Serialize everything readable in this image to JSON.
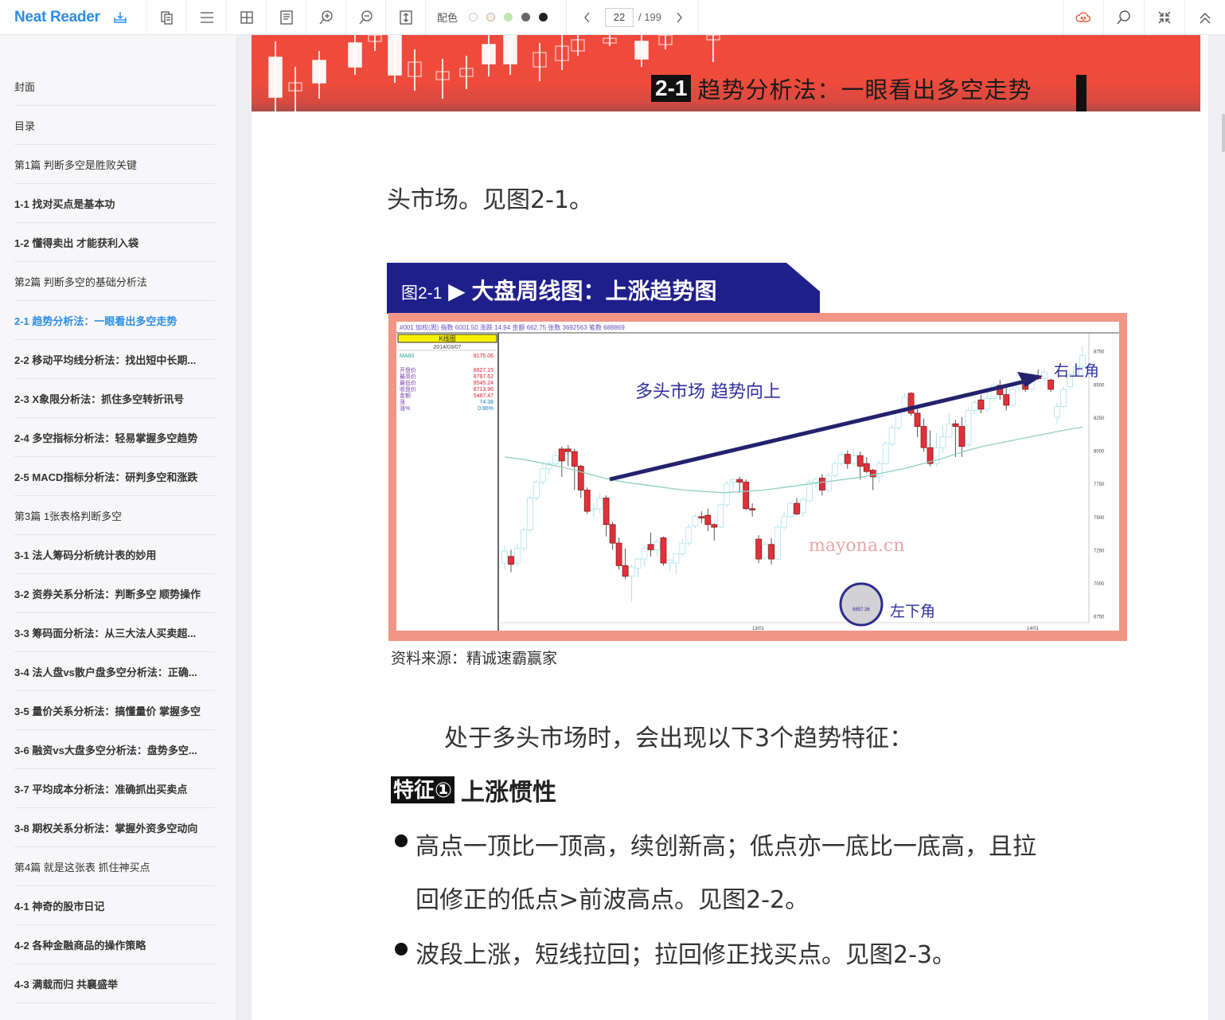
{
  "app": {
    "name": "Neat Reader",
    "icons": [
      "download-icon"
    ]
  },
  "toolbar": {
    "buttons": [
      {
        "name": "dual-page-button",
        "icon": "copy-pages-icon"
      },
      {
        "name": "toc-button",
        "icon": "menu-icon"
      },
      {
        "name": "grid-view-button",
        "icon": "grid-icon"
      },
      {
        "name": "notes-button",
        "icon": "document-icon"
      },
      {
        "name": "zoom-in-button",
        "icon": "zoom-in-icon"
      },
      {
        "name": "zoom-out-button",
        "icon": "zoom-out-icon"
      },
      {
        "name": "fit-height-button",
        "icon": "fit-height-icon"
      }
    ],
    "color_label": "配色",
    "swatches": [
      "#ffffff",
      "#f4eee3",
      "#bfe6b3",
      "#666666",
      "#222222"
    ],
    "page_current": "22",
    "page_total": "/ 199",
    "right_buttons": [
      {
        "name": "cloud-sync-button",
        "icon": "cloud-icon",
        "color": "#e8583d"
      },
      {
        "name": "search-button",
        "icon": "search-icon"
      },
      {
        "name": "fullscreen-button",
        "icon": "collapse-icon"
      },
      {
        "name": "collapse-toolbar-button",
        "icon": "chevron-double-up-icon"
      }
    ]
  },
  "sidebar": {
    "active_index": 6,
    "items": [
      {
        "label": "封面",
        "type": "part"
      },
      {
        "label": "目录",
        "type": "part"
      },
      {
        "label": "第1篇 判断多空是胜败关键",
        "type": "part"
      },
      {
        "label": "1-1 找对买点是基本功",
        "type": "chapter"
      },
      {
        "label": "1-2 懂得卖出 才能获利入袋",
        "type": "chapter"
      },
      {
        "label": "第2篇 判断多空的基础分析法",
        "type": "part"
      },
      {
        "label": "2-1 趋势分析法：一眼看出多空走势",
        "type": "chapter"
      },
      {
        "label": "2-2 移动平均线分析法：找出短中长期...",
        "type": "chapter"
      },
      {
        "label": "2-3 X象限分析法：抓住多空转折讯号",
        "type": "chapter"
      },
      {
        "label": "2-4 多空指标分析法：轻易掌握多空趋势",
        "type": "chapter"
      },
      {
        "label": "2-5 MACD指标分析法：研判多空和涨跌",
        "type": "chapter"
      },
      {
        "label": "第3篇 1张表格判断多空",
        "type": "part"
      },
      {
        "label": "3-1 法人筹码分析统计表的妙用",
        "type": "chapter"
      },
      {
        "label": "3-2 资券关系分析法：判断多空 顺势操作",
        "type": "chapter"
      },
      {
        "label": "3-3 筹码面分析法：从三大法人买卖超...",
        "type": "chapter"
      },
      {
        "label": "3-4 法人盘vs散户盘多空分析法：正确...",
        "type": "chapter"
      },
      {
        "label": "3-5 量价关系分析法：搞懂量价 掌握多空",
        "type": "chapter"
      },
      {
        "label": "3-6 融资vs大盘多空分析法：盘势多空...",
        "type": "chapter"
      },
      {
        "label": "3-7 平均成本分析法：准确抓出买卖点",
        "type": "chapter"
      },
      {
        "label": "3-8 期权关系分析法：掌握外资多空动向",
        "type": "chapter"
      },
      {
        "label": "第4篇 就是这张表 抓住神买点",
        "type": "part"
      },
      {
        "label": "4-1 神奇的股市日记",
        "type": "chapter"
      },
      {
        "label": "4-2 各种金融商品的操作策略",
        "type": "chapter"
      },
      {
        "label": "4-3 满载而归 共襄盛举",
        "type": "chapter"
      }
    ]
  },
  "page": {
    "banner_num": "2-1",
    "banner_title": "趋势分析法：一眼看出多空走势",
    "para1": "头市场。见图2-1。",
    "figure_no": "图2-1",
    "figure_arrow": "▶",
    "figure_title": "大盘周线图：上涨趋势图",
    "source": "资料来源：精诚速霸赢家",
    "para2": "处于多头市场时，会出现以下3个趋势特征：",
    "feature_tag": "特征①",
    "feature_title": "上涨惯性",
    "bullet1_line1": "高点一顶比一顶高，续创新高；低点亦一底比一底高，且拉",
    "bullet1_line2": "回修正的低点>前波高点。见图2-2。",
    "bullet2": "波段上涨，短线拉回；拉回修正找买点。见图2-3。"
  },
  "chart_data": {
    "type": "candlestick",
    "title": "大盘周线图：上涨趋势图",
    "header_line": [
      "#001 加权(周)",
      "指数",
      "6001.50",
      "涨跌",
      "14.94",
      "金额",
      "662.75",
      "张数",
      "3692563",
      "笔数",
      "688869"
    ],
    "info_panel": {
      "title": "K线图",
      "date": "2014/03/07",
      "ma_label": "MA60",
      "ma_value": "8175.06",
      "rows": [
        {
          "label": "开盘价",
          "value": "8627.15"
        },
        {
          "label": "最高价",
          "value": "8787.62"
        },
        {
          "label": "最低价",
          "value": "8545.24"
        },
        {
          "label": "收盘价",
          "value": "8713.96"
        },
        {
          "label": "金额",
          "value": "5487.47"
        },
        {
          "label": "涨",
          "value": "74.38"
        },
        {
          "label": "涨%",
          "value": "0.86%"
        }
      ]
    },
    "yticks": [
      6750,
      7000,
      7250,
      7500,
      7750,
      8000,
      8250,
      8500,
      8750
    ],
    "ylim": [
      6700,
      8850
    ],
    "xticks": [
      "13/01",
      "14/01"
    ],
    "annotations": {
      "trend_label": "多头市场 趋势向上",
      "top_right_label": "右上角",
      "bottom_left_label": "左下角",
      "high_value": "8787.62",
      "low_value": "6857.36"
    },
    "watermark": "mayona.cn",
    "candles": [
      [
        7150,
        7240,
        7100,
        7280
      ],
      [
        7200,
        7140,
        7080,
        7250
      ],
      [
        7150,
        7260,
        7120,
        7300
      ],
      [
        7260,
        7400,
        7240,
        7420
      ],
      [
        7400,
        7640,
        7380,
        7660
      ],
      [
        7640,
        7760,
        7620,
        7780
      ],
      [
        7760,
        7860,
        7740,
        7900
      ],
      [
        7860,
        7900,
        7820,
        7920
      ],
      [
        7900,
        7960,
        7880,
        7990
      ],
      [
        8010,
        7920,
        7800,
        8030
      ],
      [
        8010,
        7990,
        7880,
        8040
      ],
      [
        7990,
        7880,
        7700,
        8010
      ],
      [
        7880,
        7700,
        7640,
        7890
      ],
      [
        7700,
        7540,
        7520,
        7720
      ],
      [
        7560,
        7560,
        7500,
        7600
      ],
      [
        7560,
        7640,
        7520,
        7680
      ],
      [
        7640,
        7440,
        7350,
        7660
      ],
      [
        7440,
        7300,
        7250,
        7460
      ],
      [
        7300,
        7130,
        7100,
        7340
      ],
      [
        7130,
        7050,
        7030,
        7260
      ],
      [
        7050,
        7120,
        6860,
        7140
      ],
      [
        7110,
        7180,
        7040,
        7190
      ],
      [
        7180,
        7260,
        7130,
        7280
      ],
      [
        7290,
        7250,
        7200,
        7380
      ],
      [
        7250,
        7310,
        7200,
        7330
      ],
      [
        7340,
        7150,
        7130,
        7350
      ],
      [
        7150,
        7170,
        7090,
        7180
      ],
      [
        7150,
        7220,
        7060,
        7200
      ],
      [
        7220,
        7300,
        7200,
        7330
      ],
      [
        7300,
        7420,
        7280,
        7440
      ],
      [
        7430,
        7500,
        7410,
        7520
      ],
      [
        7500,
        7490,
        7450,
        7540
      ],
      [
        7510,
        7440,
        7390,
        7560
      ],
      [
        7440,
        7420,
        7320,
        7450
      ],
      [
        7420,
        7590,
        7410,
        7600
      ],
      [
        7590,
        7750,
        7570,
        7770
      ],
      [
        7760,
        7780,
        7700,
        7790
      ],
      [
        7780,
        7760,
        7680,
        7800
      ],
      [
        7760,
        7560,
        7550,
        7780
      ],
      [
        7560,
        7550,
        7500,
        7600
      ],
      [
        7330,
        7180,
        7150,
        7360
      ],
      [
        7190,
        7290,
        7170,
        7310
      ],
      [
        7290,
        7180,
        7140,
        7340
      ],
      [
        7180,
        7420,
        7170,
        7440
      ],
      [
        7420,
        7500,
        7400,
        7540
      ],
      [
        7500,
        7600,
        7480,
        7620
      ],
      [
        7600,
        7520,
        7510,
        7640
      ],
      [
        7530,
        7630,
        7500,
        7650
      ],
      [
        7620,
        7760,
        7600,
        7780
      ],
      [
        7760,
        7780,
        7720,
        7800
      ],
      [
        7790,
        7700,
        7660,
        7820
      ],
      [
        7700,
        7810,
        7680,
        7830
      ],
      [
        7810,
        7900,
        7790,
        7920
      ],
      [
        7900,
        7970,
        7880,
        7990
      ],
      [
        7970,
        7900,
        7860,
        8000
      ],
      [
        7900,
        7960,
        7880,
        8010
      ],
      [
        7960,
        7880,
        7780,
        7990
      ],
      [
        7900,
        7840,
        7830,
        7950
      ],
      [
        7850,
        7800,
        7700,
        7860
      ],
      [
        7800,
        7900,
        7760,
        7920
      ],
      [
        7900,
        8050,
        7890,
        8070
      ],
      [
        8050,
        8170,
        8030,
        8190
      ],
      [
        8170,
        8290,
        8150,
        8310
      ],
      [
        8300,
        8400,
        8280,
        8430
      ],
      [
        8430,
        8280,
        8260,
        8440
      ],
      [
        8280,
        8180,
        8100,
        8330
      ],
      [
        8180,
        8020,
        7990,
        8240
      ],
      [
        8020,
        7900,
        7880,
        8150
      ],
      [
        7900,
        8020,
        7880,
        8130
      ],
      [
        8020,
        8100,
        7980,
        8190
      ],
      [
        8100,
        8200,
        8090,
        8280
      ],
      [
        8200,
        8180,
        7950,
        8230
      ],
      [
        8180,
        8030,
        7950,
        8250
      ],
      [
        8040,
        8300,
        8030,
        8320
      ],
      [
        8300,
        8360,
        8270,
        8380
      ],
      [
        8380,
        8310,
        8280,
        8420
      ],
      [
        8310,
        8390,
        8290,
        8450
      ],
      [
        8390,
        8490,
        8370,
        8510
      ],
      [
        8490,
        8420,
        8380,
        8530
      ],
      [
        8420,
        8340,
        8300,
        8490
      ],
      [
        8340,
        8460,
        8330,
        8480
      ],
      [
        8470,
        8520,
        8440,
        8540
      ],
      [
        8520,
        8460,
        8440,
        8580
      ],
      [
        8460,
        8560,
        8440,
        8590
      ],
      [
        8560,
        8540,
        8530,
        8610
      ],
      [
        8540,
        8590,
        8520,
        8620
      ],
      [
        8530,
        8460,
        8440,
        8540
      ],
      [
        8250,
        8330,
        8200,
        8360
      ],
      [
        8330,
        8460,
        8320,
        8480
      ],
      [
        8480,
        8570,
        8460,
        8590
      ],
      [
        8570,
        8630,
        8560,
        8650
      ],
      [
        8627,
        8714,
        8545,
        8788
      ]
    ],
    "ma_series": [
      7950,
      7930,
      7900,
      7870,
      7830,
      7790,
      7760,
      7740,
      7720,
      7700,
      7690,
      7680,
      7690,
      7700,
      7720,
      7740,
      7760,
      7780,
      7800,
      7830,
      7860,
      7900,
      7940,
      7990,
      8030,
      8060,
      8090,
      8120,
      8150,
      8175
    ],
    "colors": {
      "up": "#aee3ef",
      "down": "#e0313a",
      "ma": "#8ecfc4",
      "arrow": "#22226e",
      "label": "#2f2f9e"
    }
  }
}
